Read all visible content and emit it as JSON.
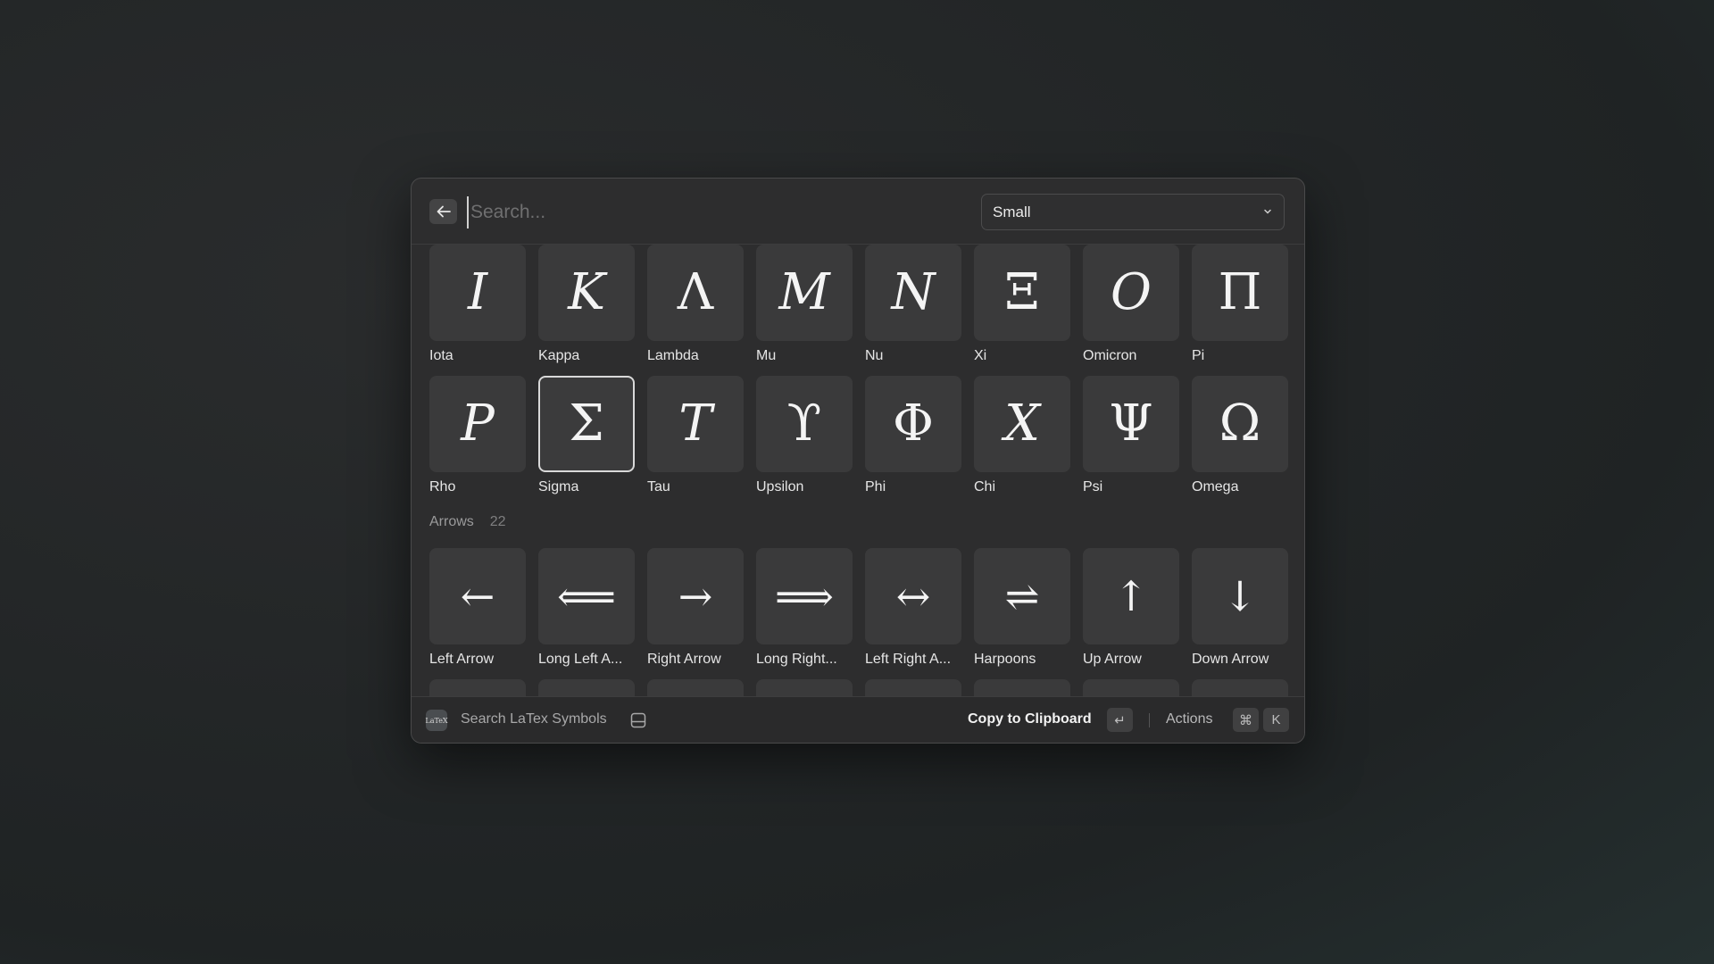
{
  "search": {
    "placeholder": "Search...",
    "value": ""
  },
  "size_dropdown": {
    "selected": "Small"
  },
  "rows_top": [
    [
      {
        "glyph": "I",
        "name": "Iota",
        "italic": true
      },
      {
        "glyph": "K",
        "name": "Kappa",
        "italic": true
      },
      {
        "glyph": "Λ",
        "name": "Lambda",
        "italic": false
      },
      {
        "glyph": "M",
        "name": "Mu",
        "italic": true
      },
      {
        "glyph": "N",
        "name": "Nu",
        "italic": true
      },
      {
        "glyph": "Ξ",
        "name": "Xi",
        "italic": false
      },
      {
        "glyph": "O",
        "name": "Omicron",
        "italic": true
      },
      {
        "glyph": "Π",
        "name": "Pi",
        "italic": false
      }
    ],
    [
      {
        "glyph": "P",
        "name": "Rho",
        "italic": true
      },
      {
        "glyph": "Σ",
        "name": "Sigma",
        "italic": false,
        "selected": true
      },
      {
        "glyph": "T",
        "name": "Tau",
        "italic": true
      },
      {
        "glyph": "ϒ",
        "name": "Upsilon",
        "italic": false
      },
      {
        "glyph": "Φ",
        "name": "Phi",
        "italic": false
      },
      {
        "glyph": "X",
        "name": "Chi",
        "italic": true
      },
      {
        "glyph": "Ψ",
        "name": "Psi",
        "italic": false
      },
      {
        "glyph": "Ω",
        "name": "Omega",
        "italic": false
      }
    ]
  ],
  "arrows_section": {
    "title": "Arrows",
    "count": "22",
    "items": [
      {
        "glyph": "←",
        "name": "Left Arrow"
      },
      {
        "glyph": "⟸",
        "name": "Long Left A..."
      },
      {
        "glyph": "→",
        "name": "Right Arrow"
      },
      {
        "glyph": "⟹",
        "name": "Long Right..."
      },
      {
        "glyph": "↔",
        "name": "Left Right A..."
      },
      {
        "glyph": "⇌",
        "name": "Harpoons"
      },
      {
        "glyph": "↑",
        "name": "Up Arrow"
      },
      {
        "glyph": "↓",
        "name": "Down Arrow"
      }
    ]
  },
  "footer": {
    "app_icon_text": "LaTeX",
    "app_title": "Search LaTex Symbols",
    "primary_action": "Copy to Clipboard",
    "primary_key": "↵",
    "actions_label": "Actions",
    "actions_keys": [
      "⌘",
      "K"
    ]
  }
}
